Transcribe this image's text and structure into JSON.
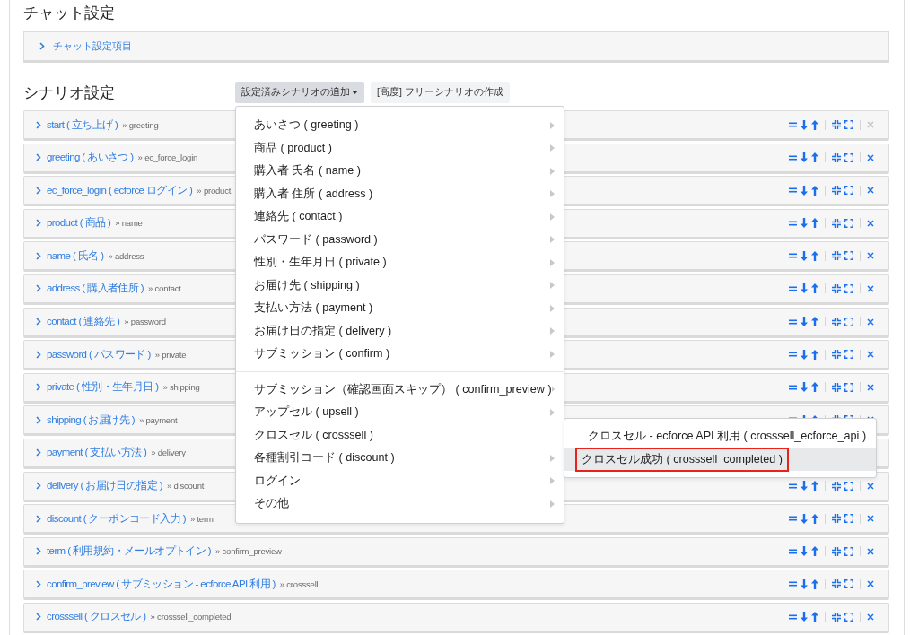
{
  "chat_settings": {
    "title": "チャット設定",
    "panel": {
      "label": "チャット設定項目",
      "expanded": false
    }
  },
  "scenario_settings": {
    "title": "シナリオ設定",
    "buttons": [
      {
        "label": "設定済みシナリオの追加",
        "kind": "dropdown"
      },
      {
        "label": "[高度] フリーシナリオの作成",
        "kind": "plain"
      }
    ],
    "rows": [
      {
        "name": "start ( 立ち上げ )",
        "next": "» greeting",
        "delete_enabled": false
      },
      {
        "name": "greeting ( あいさつ )",
        "next": "» ec_force_login",
        "delete_enabled": true
      },
      {
        "name": "ec_force_login ( ecforce ログイン )",
        "next": "» product",
        "delete_enabled": true
      },
      {
        "name": "product ( 商品 )",
        "next": "» name",
        "delete_enabled": true
      },
      {
        "name": "name ( 氏名 )",
        "next": "» address",
        "delete_enabled": true
      },
      {
        "name": "address ( 購入者住所 )",
        "next": "» contact",
        "delete_enabled": true
      },
      {
        "name": "contact ( 連絡先 )",
        "next": "» password",
        "delete_enabled": true
      },
      {
        "name": "password ( パスワード )",
        "next": "» private",
        "delete_enabled": true
      },
      {
        "name": "private ( 性別・生年月日 )",
        "next": "» shipping",
        "delete_enabled": true
      },
      {
        "name": "shipping ( お届け先 )",
        "next": "» payment",
        "delete_enabled": true
      },
      {
        "name": "payment ( 支払い方法 )",
        "next": "» delivery"
      },
      {
        "name": "delivery ( お届け日の指定 )",
        "next": "» discount",
        "delete_enabled": true
      },
      {
        "name": "discount ( クーポンコード入力 )",
        "next": "» term",
        "delete_enabled": true
      },
      {
        "name": "term ( 利用規約・メールオプトイン )",
        "next": "» confirm_preview",
        "delete_enabled": true
      },
      {
        "name": "confirm_preview ( サブミッション - ecforce API 利用 )",
        "next": "» crosssell",
        "delete_enabled": true
      },
      {
        "name": "crosssell ( クロスセル )",
        "next": "» crosssell_completed",
        "delete_enabled": true
      }
    ]
  },
  "dropdown_menu": {
    "groups": [
      [
        {
          "label": "あいさつ ( greeting )",
          "submenu": true
        },
        {
          "label": "商品 ( product )",
          "submenu": true
        },
        {
          "label": "購入者 氏名 ( name )",
          "submenu": true
        },
        {
          "label": "購入者 住所 ( address )",
          "submenu": true
        },
        {
          "label": "連絡先 ( contact )",
          "submenu": true
        },
        {
          "label": "パスワード ( password )",
          "submenu": true
        },
        {
          "label": "性別・生年月日 ( private )",
          "submenu": true
        },
        {
          "label": "お届け先 ( shipping )",
          "submenu": true
        },
        {
          "label": "支払い方法 ( payment )",
          "submenu": true
        },
        {
          "label": "お届け日の指定 ( delivery )",
          "submenu": true
        },
        {
          "label": "サブミッション ( confirm )",
          "submenu": true
        }
      ],
      [
        {
          "label": "サブミッション（確認画面スキップ） ( confirm_preview )",
          "submenu": true
        },
        {
          "label": "アップセル ( upsell )",
          "submenu": true
        },
        {
          "label": "クロスセル ( crosssell )",
          "submenu": false
        },
        {
          "label": "各種割引コード ( discount )",
          "submenu": true
        },
        {
          "label": "ログイン",
          "submenu": true
        },
        {
          "label": "その他",
          "submenu": true
        }
      ]
    ]
  },
  "submenu": {
    "items": [
      {
        "label": "クロスセル - ecforce API 利用 ( crosssell_ecforce_api )",
        "selected": false,
        "outlined": false
      },
      {
        "label": "クロスセル成功 ( crosssell_completed )",
        "selected": true,
        "outlined": true
      }
    ]
  }
}
